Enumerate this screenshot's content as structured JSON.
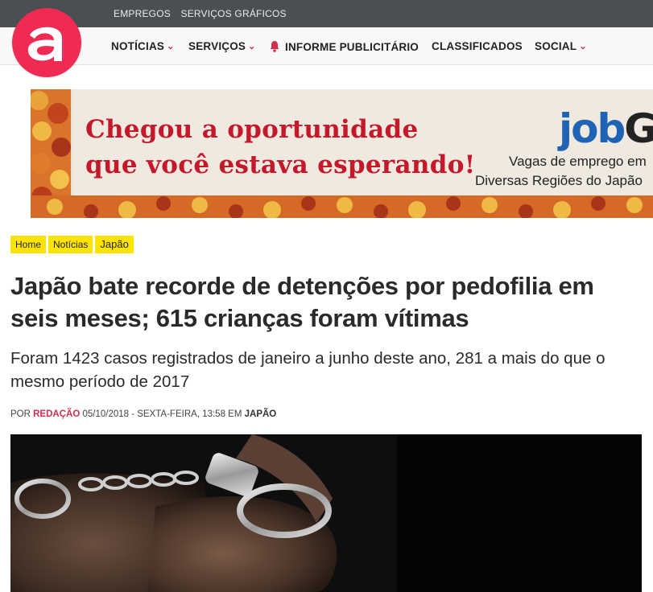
{
  "topbar": {
    "links": [
      "EMPREGOS",
      "SERVIÇOS GRÁFICOS"
    ]
  },
  "logo": {
    "letter": "a",
    "color": "#ef2b54"
  },
  "nav": {
    "noticias": "NOTÍCIAS",
    "servicos": "SERVIÇOS",
    "informe": "INFORME PUBLICITÁRIO",
    "classificados": "CLASSIFICADOS",
    "social": "SOCIAL",
    "accent": "#d32f4c"
  },
  "banner": {
    "headline_line1": "Chegou a oportunidade",
    "headline_line2": "que você estava esperando!",
    "brand_part1": "job",
    "brand_part2": "GU",
    "sub_line1": "Vagas de emprego em",
    "sub_line2": "Diversas Regiões do Japão"
  },
  "breadcrumbs": [
    "Home",
    "Notícias",
    "Japão"
  ],
  "article": {
    "title": "Japão bate recorde de detenções por pedofilia em seis meses; 615 crianças foram vítimas",
    "subtitle": "Foram 1423 casos registrados de janeiro a junho deste ano, 281 a mais do que o mesmo período de 2017",
    "meta": {
      "by": "POR",
      "author": "REDAÇÃO",
      "date": "05/10/2018 - SEXTA-FEIRA, 13:58",
      "in": "EM",
      "category": "JAPÃO"
    }
  }
}
